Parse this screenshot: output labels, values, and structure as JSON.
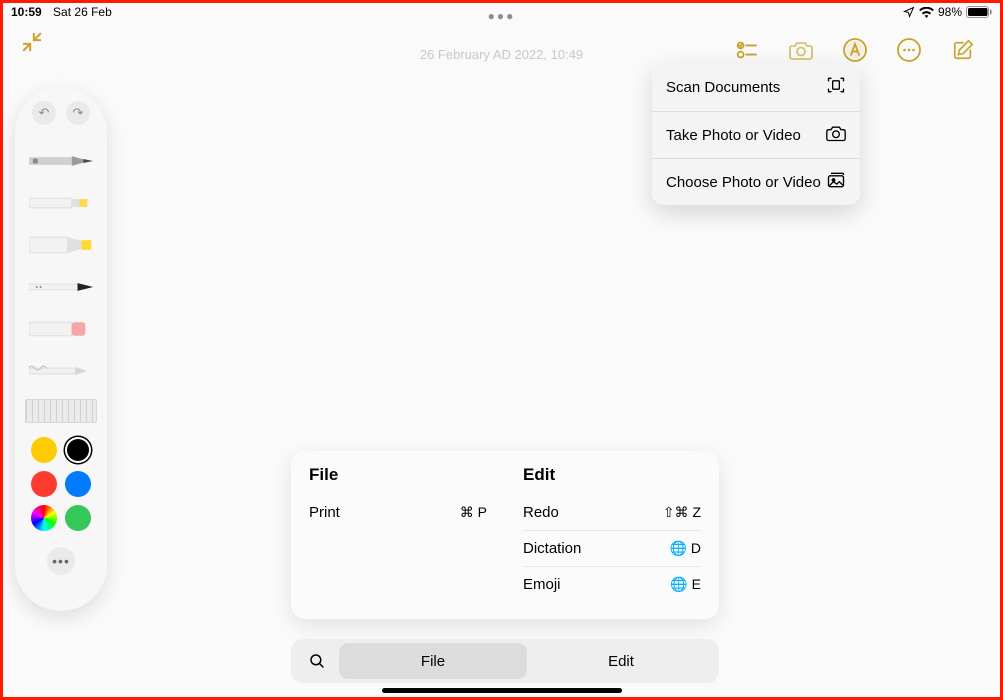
{
  "status": {
    "time": "10:59",
    "date": "Sat 26 Feb",
    "battery_pct": "98%"
  },
  "note": {
    "date_header": "26 February AD 2022, 10:49"
  },
  "camera_menu": {
    "items": [
      {
        "label": "Scan Documents"
      },
      {
        "label": "Take Photo or Video"
      },
      {
        "label": "Choose Photo or Video"
      }
    ]
  },
  "shortcuts": {
    "file": {
      "title": "File",
      "items": [
        {
          "label": "Print",
          "keys": "⌘ P"
        }
      ]
    },
    "edit": {
      "title": "Edit",
      "items": [
        {
          "label": "Redo",
          "keys": "⇧⌘ Z"
        },
        {
          "label": "Dictation",
          "keys": "🌐 D"
        },
        {
          "label": "Emoji",
          "keys": "🌐 E"
        }
      ]
    },
    "tabs": {
      "file": "File",
      "edit": "Edit"
    }
  }
}
